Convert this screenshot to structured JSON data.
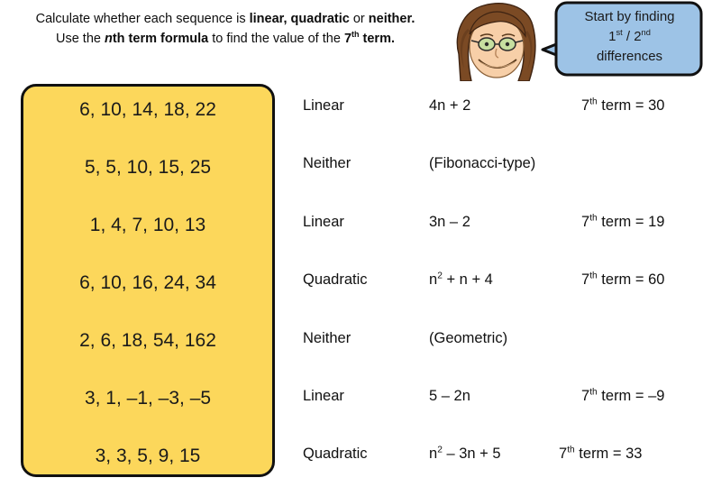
{
  "instructions": {
    "line1_a": "Calculate whether each sequence is ",
    "line1_b": "linear, quadratic",
    "line1_c": " or ",
    "line1_d": "neither.",
    "line2_a": "Use the ",
    "line2_b_italic": "n",
    "line2_b": "th term formula",
    "line2_c": " to find the value of the ",
    "line2_d": "7",
    "line2_d_sup": "th",
    "line2_e": " term."
  },
  "callout": {
    "line1": "Start by finding",
    "line2_a": "1",
    "line2_sup_a": "st",
    "line2_b": " / 2",
    "line2_sup_b": "nd",
    "line3": "differences",
    "fill_color": "#9DC3E6",
    "stroke_color": "#111111"
  },
  "face": {
    "skin_color": "#F7CFA8",
    "hair_color": "#7B4A24",
    "glasses_lens_color": "#C6DFA0",
    "outline_color": "#1a1a1a"
  },
  "panel": {
    "fill_color": "#FCD75B",
    "border_color": "#111111"
  },
  "rows": [
    {
      "sequence": "6, 10, 14, 18, 22",
      "kind": "Linear",
      "formula": "4n + 2",
      "term_label": "7",
      "term_sup": "th",
      "term_rest": " term = 30"
    },
    {
      "sequence": "5, 5, 10, 15, 25",
      "kind": "Neither",
      "formula": "(Fibonacci-type)",
      "term_label": "",
      "term_sup": "",
      "term_rest": ""
    },
    {
      "sequence": "1, 4, 7, 10, 13",
      "kind": "Linear",
      "formula": "3n – 2",
      "term_label": "7",
      "term_sup": "th",
      "term_rest": " term = 19"
    },
    {
      "sequence": "6, 10, 16, 24, 34",
      "kind": "Quadratic",
      "formula_pre": "n",
      "formula_sup": "2",
      "formula_post": " + n + 4",
      "formula": "n2 + n + 4",
      "term_label": "7",
      "term_sup": "th",
      "term_rest": " term = 60"
    },
    {
      "sequence": "2, 6, 18, 54, 162",
      "kind": "Neither",
      "formula": "(Geometric)",
      "term_label": "",
      "term_sup": "",
      "term_rest": ""
    },
    {
      "sequence": "3, 1, –1, –3, –5",
      "kind": "Linear",
      "formula": "5 – 2n",
      "term_label": "7",
      "term_sup": "th",
      "term_rest": " term = –9"
    },
    {
      "sequence": "3, 3, 5, 9, 15",
      "kind": "Quadratic",
      "formula_pre": "n",
      "formula_sup": "2",
      "formula_post": " – 3n + 5",
      "formula": "n2 – 3n + 5",
      "term_label": "7",
      "term_sup": "th",
      "term_rest": " term = 33"
    }
  ]
}
